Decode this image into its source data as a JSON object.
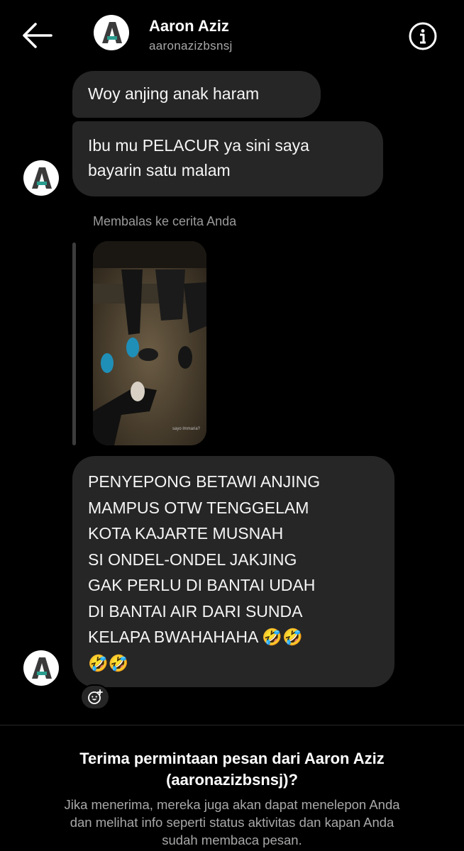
{
  "header": {
    "name": "Aaron Aziz",
    "username": "aaronazizbsnsj",
    "avatar_letter": "A",
    "back_icon": "arrow-left-icon",
    "info_icon": "info-circle-icon"
  },
  "messages": [
    {
      "text": "Woy anjing anak haram"
    },
    {
      "lines": [
        "Ibu mu PELACUR ya sini saya",
        "bayarin satu malam"
      ]
    }
  ],
  "story_reply": {
    "label": "Membalas ke cerita Anda",
    "thumbnail_caption": "sayo lmmaria?"
  },
  "message3": {
    "lines": [
      "PENYEPONG BETAWI ANJING",
      "MAMPUS OTW TENGGELAM",
      "KOTA KAJARTE MUSNAH",
      "SI ONDEL-ONDEL JAKJING",
      "GAK PERLU DI BANTAI UDAH",
      "DI BANTAI AIR DARI SUNDA",
      "KELAPA BWAHAHAHA 🤣🤣",
      "🤣🤣"
    ]
  },
  "reaction_icon": "add-reaction-icon",
  "request": {
    "title_lines": [
      "Terima permintaan pesan dari Aaron Aziz",
      "(aaronazizbsnsj)?"
    ],
    "desc_lines": [
      "Jika menerima, mereka juga akan dapat menelepon Anda",
      "dan melihat info seperti status aktivitas dan kapan Anda",
      "sudah membaca pesan."
    ]
  },
  "colors": {
    "background": "#000000",
    "bubble": "#262626",
    "secondary_text": "#a8a8a8"
  }
}
